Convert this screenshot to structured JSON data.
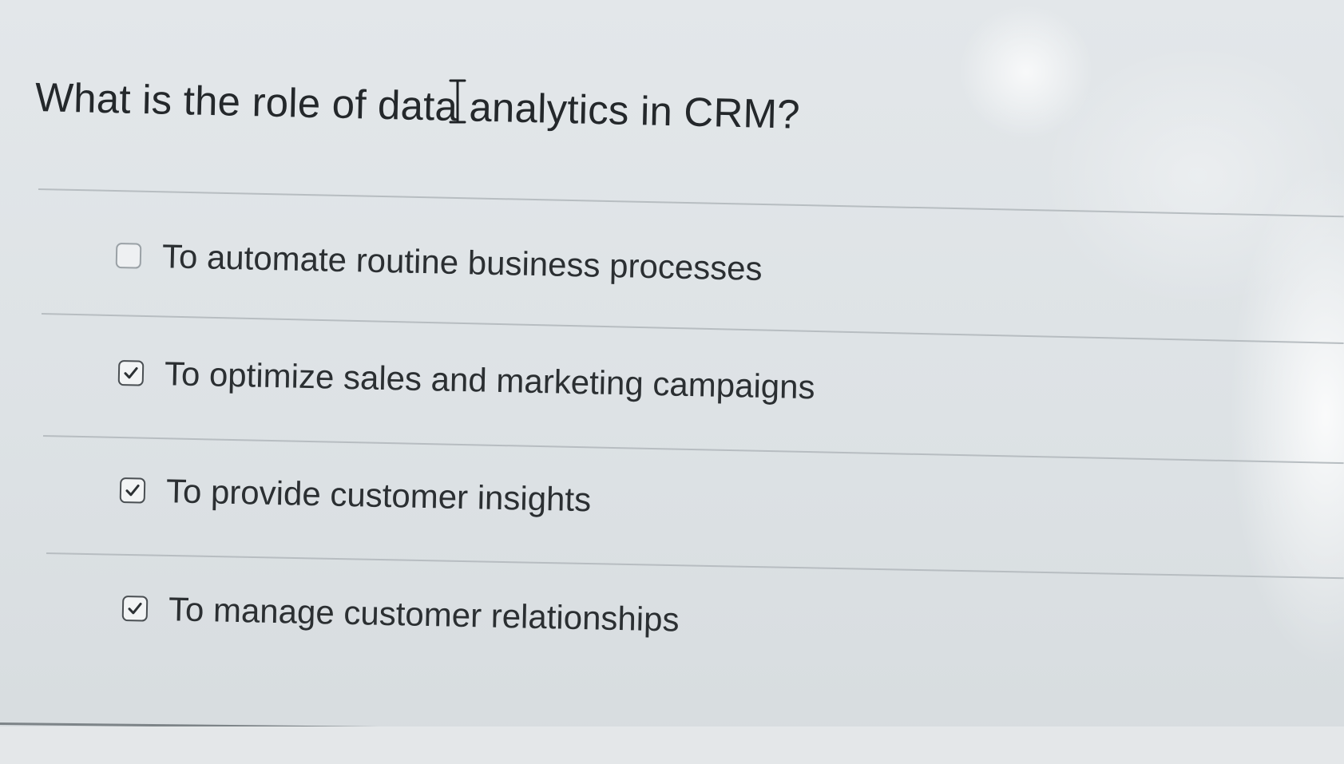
{
  "question": {
    "text": "What is the role of data analytics in CRM?"
  },
  "options": [
    {
      "label": "To automate routine business processes",
      "checked": false
    },
    {
      "label": "To optimize sales and marketing campaigns",
      "checked": true
    },
    {
      "label": "To provide customer insights",
      "checked": true
    },
    {
      "label": "To manage customer relationships",
      "checked": true
    }
  ],
  "icons": {
    "cursor": "text-cursor-icon",
    "check": "checkmark-icon"
  },
  "colors": {
    "text": "#24282b",
    "checkbox_border": "#4a4f53",
    "divider": "#b7bdc1"
  }
}
